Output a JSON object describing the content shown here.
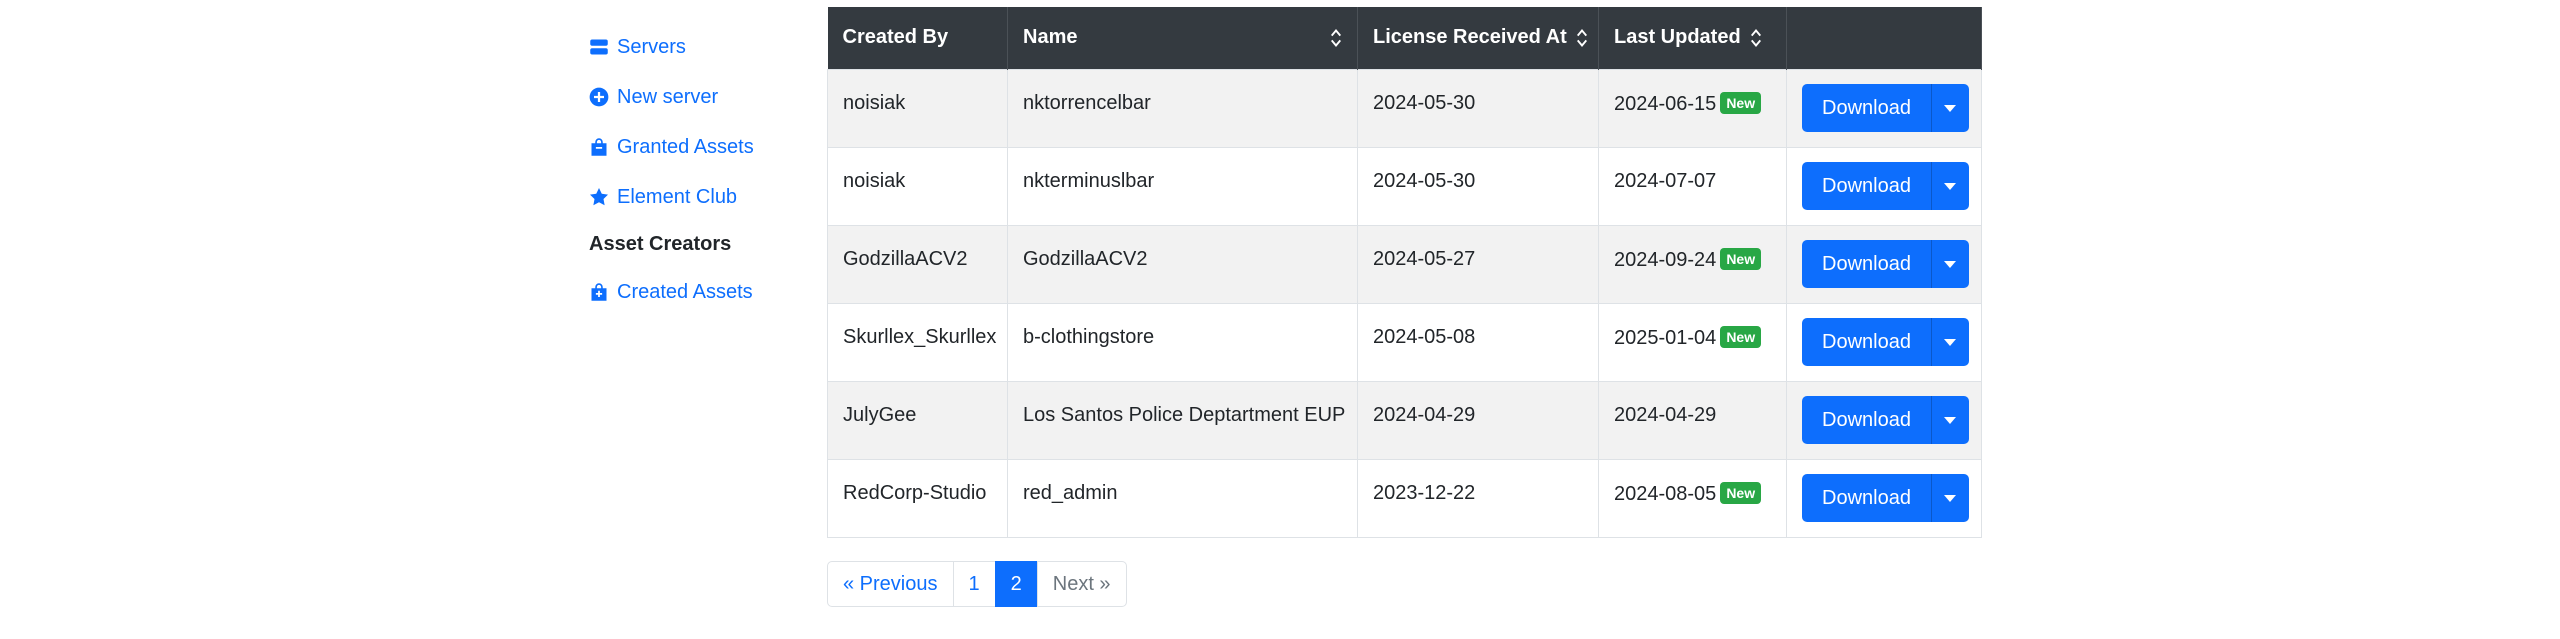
{
  "sidebar": {
    "items": [
      {
        "label": "Servers",
        "icon": "server-icon"
      },
      {
        "label": "New server",
        "icon": "plus-circle-icon"
      },
      {
        "label": "Granted Assets",
        "icon": "bag-icon"
      },
      {
        "label": "Element Club",
        "icon": "star-icon"
      },
      {
        "label": "Asset Creators",
        "icon": ""
      },
      {
        "label": "Created Assets",
        "icon": "bag-plus-icon"
      }
    ]
  },
  "table": {
    "headers": {
      "created_by": "Created By",
      "name": "Name",
      "license": "License Received At",
      "updated": "Last Updated"
    },
    "rows": [
      {
        "created_by": "noisiak",
        "name": "nktorrencelbar",
        "license": "2024-05-30",
        "updated": "2024-06-15",
        "badge": "New",
        "action": "Download"
      },
      {
        "created_by": "noisiak",
        "name": "nkterminuslbar",
        "license": "2024-05-30",
        "updated": "2024-07-07",
        "badge": "",
        "action": "Download"
      },
      {
        "created_by": "GodzillaACV2",
        "name": "GodzillaACV2",
        "license": "2024-05-27",
        "updated": "2024-09-24",
        "badge": "New",
        "action": "Download"
      },
      {
        "created_by": "Skurllex_Skurllex",
        "name": "b-clothingstore",
        "license": "2024-05-08",
        "updated": "2025-01-04",
        "badge": "New",
        "action": "Download"
      },
      {
        "created_by": "JulyGee",
        "name": "Los Santos Police Deptartment EUP",
        "license": "2024-04-29",
        "updated": "2024-04-29",
        "badge": "",
        "action": "Download"
      },
      {
        "created_by": "RedCorp-Studio",
        "name": "red_admin",
        "license": "2023-12-22",
        "updated": "2024-08-05",
        "badge": "New",
        "action": "Download"
      }
    ]
  },
  "pagination": {
    "previous": "« Previous",
    "pages": [
      "1",
      "2"
    ],
    "current": "2",
    "next": "Next »"
  },
  "colors": {
    "accent": "#0d6efd",
    "header_bg": "#343a40",
    "badge_new": "#28a745",
    "stripe": "#f2f2f2"
  }
}
